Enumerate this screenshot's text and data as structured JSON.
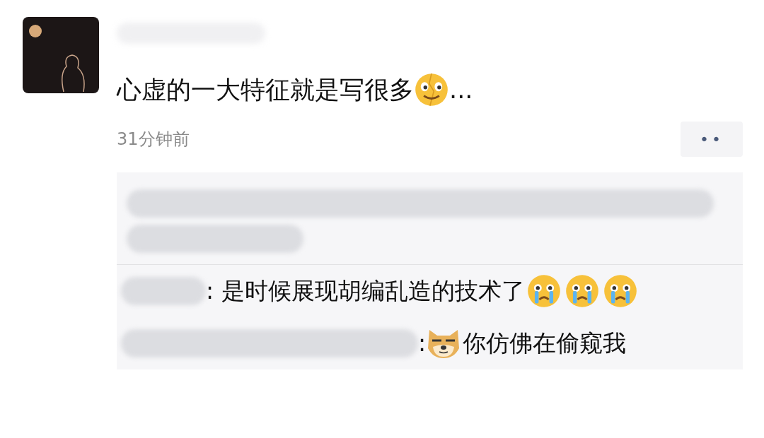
{
  "post": {
    "segments": [
      {
        "kind": "text",
        "text": "心虚的一大特征就是写很多"
      },
      {
        "kind": "smirk-emoji"
      },
      {
        "kind": "text",
        "text": "..."
      }
    ],
    "time": "31分钟前",
    "more_button": "••"
  },
  "comments": [
    {
      "kind": "blurred"
    },
    {
      "kind": "comment",
      "segments": [
        {
          "kind": "text",
          "text": ": 是时候展现胡编乱造的技术了"
        },
        {
          "kind": "crying-emoji"
        },
        {
          "kind": "crying-emoji"
        },
        {
          "kind": "crying-emoji"
        }
      ]
    },
    {
      "kind": "comment",
      "segments": [
        {
          "kind": "text",
          "text": ": "
        },
        {
          "kind": "doge-emoji"
        },
        {
          "kind": "text",
          "text": "你仿佛在偷窥我"
        }
      ]
    }
  ]
}
